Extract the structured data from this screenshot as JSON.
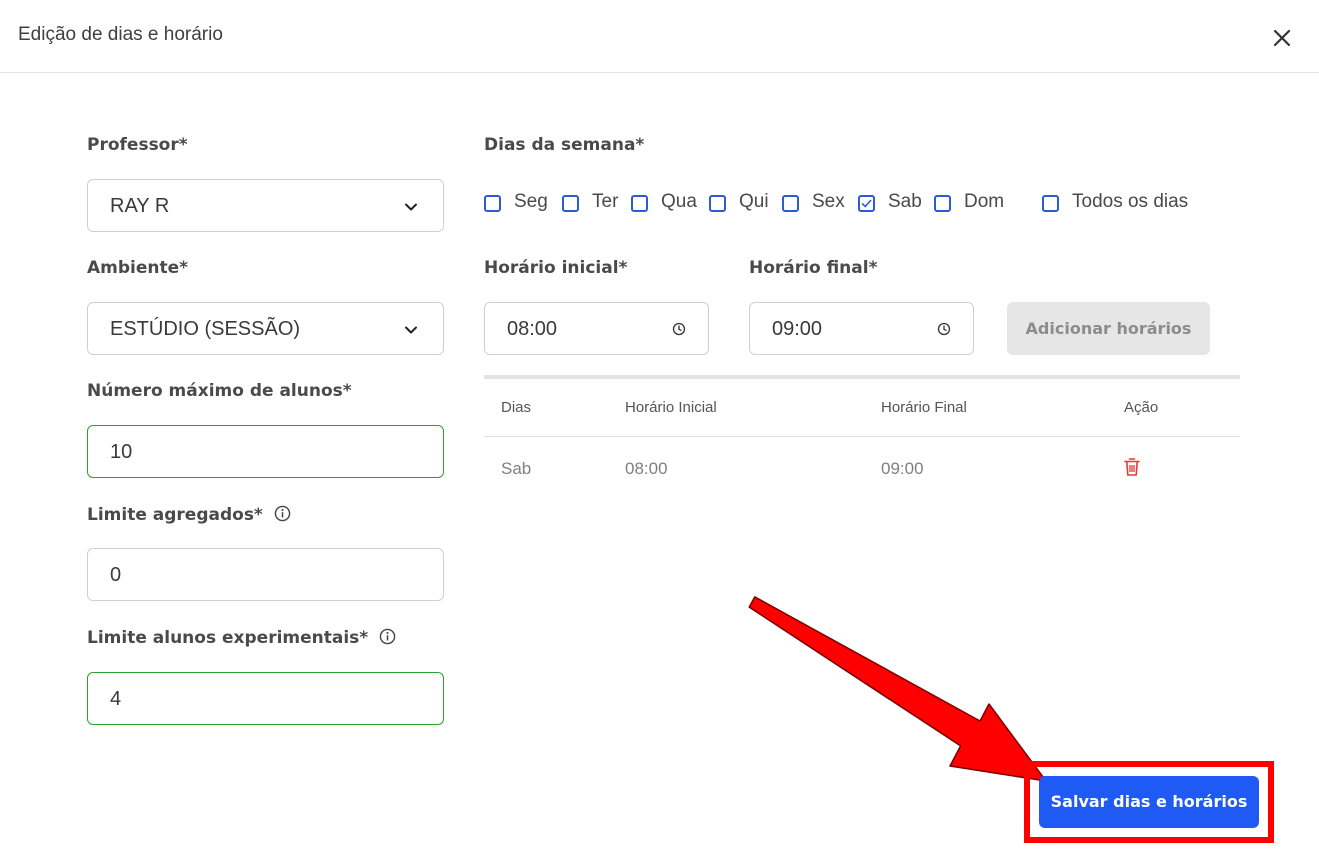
{
  "modal": {
    "title": "Edição de dias e horário"
  },
  "form": {
    "professor": {
      "label": "Professor*",
      "value": "RAY R"
    },
    "ambiente": {
      "label": "Ambiente*",
      "value": "ESTÚDIO (SESSÃO)"
    },
    "max_alunos": {
      "label": "Número máximo de alunos*",
      "value": "10"
    },
    "limite_agregados": {
      "label": "Limite agregados*",
      "value": "0"
    },
    "limite_experimentais": {
      "label": "Limite alunos experimentais*",
      "value": "4"
    }
  },
  "schedule": {
    "days_label": "Dias da semana*",
    "days": [
      {
        "label": "Seg",
        "checked": false
      },
      {
        "label": "Ter",
        "checked": false
      },
      {
        "label": "Qua",
        "checked": false
      },
      {
        "label": "Qui",
        "checked": false
      },
      {
        "label": "Sex",
        "checked": false
      },
      {
        "label": "Sab",
        "checked": true
      },
      {
        "label": "Dom",
        "checked": false
      }
    ],
    "all_days_label": "Todos os dias",
    "start_label": "Horário inicial*",
    "start_value": "08:00",
    "end_label": "Horário final*",
    "end_value": "09:00",
    "add_button": "Adicionar horários"
  },
  "table": {
    "headers": [
      "Dias",
      "Horário Inicial",
      "Horário Final",
      "Ação"
    ],
    "rows": [
      {
        "dias": "Sab",
        "inicial": "08:00",
        "final": "09:00"
      }
    ]
  },
  "footer": {
    "save_button": "Salvar dias e horários"
  },
  "colors": {
    "primary": "#1f5af5",
    "checkbox": "#2d5bd0",
    "valid_border": "#2ea033",
    "danger": "#e53935",
    "annotation": "#ff0000"
  }
}
